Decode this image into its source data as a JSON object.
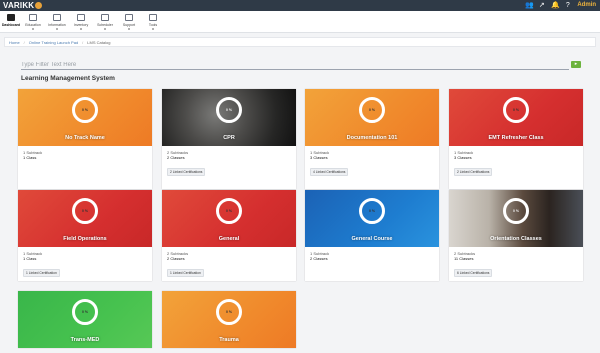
{
  "brand": {
    "logo_text": "VARIKK"
  },
  "topbar": {
    "user_label": "Admin"
  },
  "nav": [
    {
      "label": "Dashboard",
      "icon": "home-icon"
    },
    {
      "label": "Education",
      "icon": "graduation-cap-icon"
    },
    {
      "label": "Information",
      "icon": "car-icon"
    },
    {
      "label": "Inventory",
      "icon": "box-icon"
    },
    {
      "label": "Scheduler",
      "icon": "calendar-icon"
    },
    {
      "label": "Support",
      "icon": "lifebuoy-icon"
    },
    {
      "label": "Tools",
      "icon": "wrench-icon"
    }
  ],
  "breadcrumb": {
    "home": "Home",
    "level1": "Online Training Launch Pad",
    "current": "LMS Catalog"
  },
  "filter": {
    "placeholder": "Type Filter Text Here",
    "button": "▸"
  },
  "section_title": "Learning Management System",
  "cards": [
    {
      "title": "No Track Name",
      "progress": "0 %",
      "subtracks": "1 Subtrack",
      "classes": "1 Class",
      "badge": ""
    },
    {
      "title": "CPR",
      "progress": "0 %",
      "subtracks": "2 Subtracks",
      "classes": "2 Classes",
      "badge": "2 Linked Certifications"
    },
    {
      "title": "Documentation 101",
      "progress": "0 %",
      "subtracks": "1 Subtrack",
      "classes": "3 Classes",
      "badge": "4 Linked Certifications"
    },
    {
      "title": "EMT Refresher Class",
      "progress": "0 %",
      "subtracks": "1 Subtrack",
      "classes": "3 Classes",
      "badge": "2 Linked Certifications"
    },
    {
      "title": "Field Operations",
      "progress": "0 %",
      "subtracks": "1 Subtrack",
      "classes": "1 Class",
      "badge": "1 Linked Certification"
    },
    {
      "title": "General",
      "progress": "0 %",
      "subtracks": "2 Subtracks",
      "classes": "2 Classes",
      "badge": "1 Linked Certification"
    },
    {
      "title": "General Course",
      "progress": "0 %",
      "subtracks": "1 Subtrack",
      "classes": "2 Classes",
      "badge": ""
    },
    {
      "title": "Orientation Classes",
      "progress": "0 %",
      "subtracks": "2 Subtracks",
      "classes": "11 Classes",
      "badge": "6 Linked Certifications"
    },
    {
      "title": "Trans-MED",
      "progress": "0 %",
      "subtracks": "",
      "classes": "",
      "badge": ""
    },
    {
      "title": "Trauma",
      "progress": "0 %",
      "subtracks": "",
      "classes": "",
      "badge": ""
    }
  ]
}
